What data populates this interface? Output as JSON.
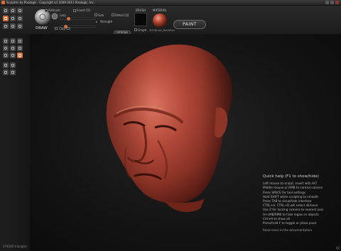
{
  "window": {
    "title": "Sculptris by Pixologic - Copyright (c) 2009-2011 Pixologic, Inc."
  },
  "toolbar": {
    "mode_label": "DRAW",
    "tool_options": {
      "airbrush_label": "Airbrush",
      "invert_label": "Invert [X]",
      "lazy_label": "Lazy",
      "size_label": "Size",
      "detail_label": "Detail [Q]",
      "strength_label": "Strength",
      "clay_label": "Clay [D]",
      "options_label": "OPTIONS",
      "size_value": 0.2,
      "strength_value": 0.12
    },
    "brush_label": "BRUSH",
    "graph_label": "Graph",
    "material_label": "MATERIAL",
    "material_name": "SOCBrush_Red4Hex",
    "paint_button": "PAINT"
  },
  "help": {
    "title": "Quick help (F1 to show/hide)",
    "lines": [
      "Left mouse to sculpt, invert with ALT",
      "Middle mouse or RMB to control camera",
      "Press SPACE for tool settings",
      "Hold SHIFT while sculpting to smooth",
      "Press TAB to show/hide interface",
      "CTRL+A, CTRL+D will select all/none",
      "Use Z for locking camera to nearest axis",
      "H+LMB/RMB to hide region or objects",
      "Ctrl+H to show all",
      "Press/hold F to toggle or place pivot"
    ],
    "doc_link": "Read more in the documentation"
  },
  "status": {
    "triangles": "374240 triangles"
  },
  "colors": {
    "accent": "#d2703a",
    "clay": "#b04a3c",
    "background": "#141414"
  }
}
